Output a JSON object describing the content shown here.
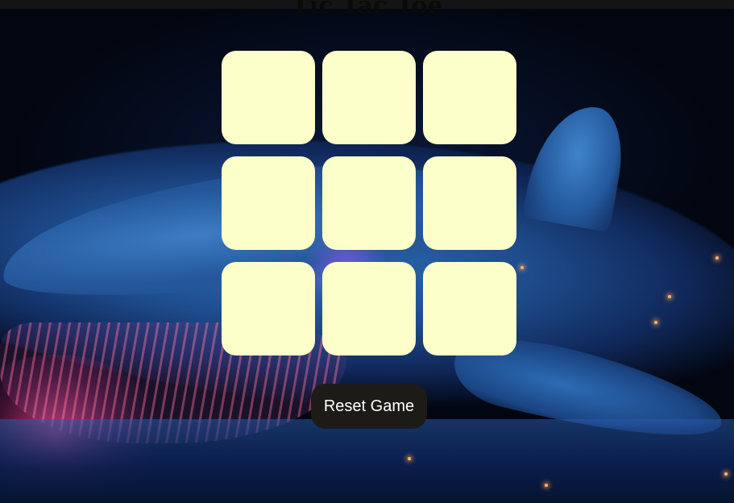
{
  "page": {
    "title": "Tic Tac Toe"
  },
  "board": {
    "cells": [
      "",
      "",
      "",
      "",
      "",
      "",
      "",
      "",
      ""
    ]
  },
  "controls": {
    "reset_label": "Reset Game"
  },
  "colors": {
    "cell": "#fdffca",
    "button": "#1c1b17",
    "top_bar": "#141414"
  }
}
